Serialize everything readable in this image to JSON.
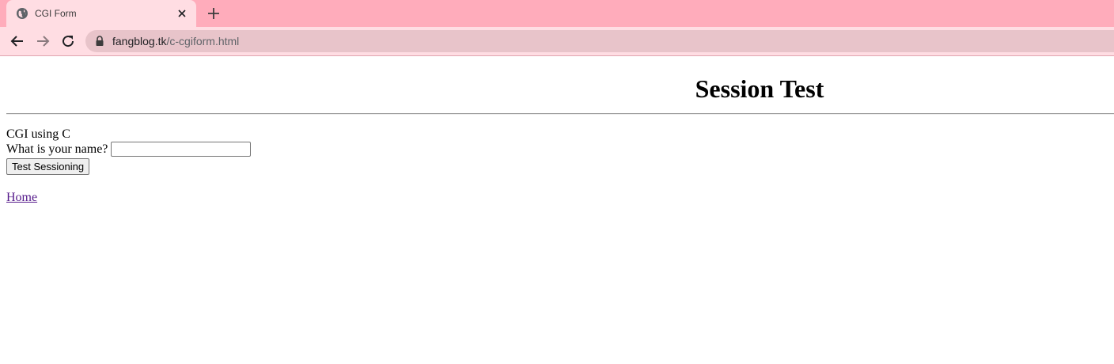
{
  "browser": {
    "tab": {
      "title": "CGI Form",
      "favicon": "globe-icon"
    },
    "address_bar": {
      "host": "fangblog.tk",
      "path": "/c-cgiform.html"
    },
    "colors": {
      "frame": "#ffacbb",
      "toolbar": "#ffdde3",
      "omnibox": "#e8c4ca"
    }
  },
  "page": {
    "heading": "Session Test",
    "subtitle": "CGI using C",
    "name_label": "What is your name?",
    "name_input_value": "",
    "submit_label": "Test Sessioning",
    "home_link": "Home",
    "colors": {
      "visited_link": "#551a8b",
      "hr": "#9a9a9a"
    }
  }
}
